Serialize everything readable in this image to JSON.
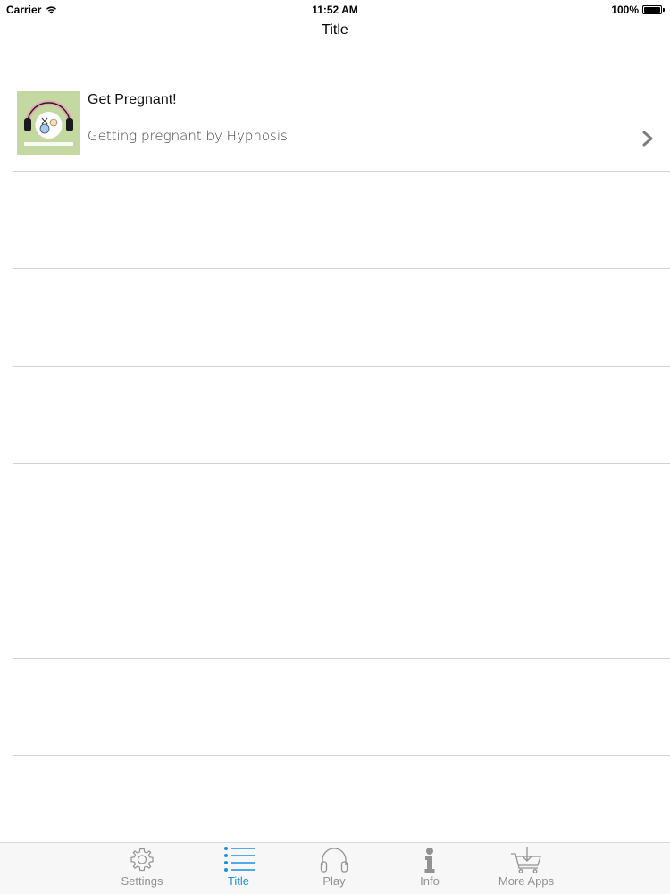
{
  "status_bar": {
    "carrier": "Carrier",
    "time": "11:52 AM",
    "battery": "100%"
  },
  "nav": {
    "title": "Title"
  },
  "list": {
    "items": [
      {
        "title": "Get Pregnant!",
        "subtitle": "Getting pregnant by Hypnosis",
        "icon": "headphones-baby-artwork"
      }
    ]
  },
  "tab_bar": {
    "active_color": "#1a8fe0",
    "inactive_color": "#929292",
    "tabs": [
      {
        "label": "Settings",
        "icon": "gear-icon"
      },
      {
        "label": "Title",
        "icon": "list-icon"
      },
      {
        "label": "Play",
        "icon": "headphones-icon"
      },
      {
        "label": "Info",
        "icon": "info-icon"
      },
      {
        "label": "More Apps",
        "icon": "cart-icon"
      }
    ]
  }
}
